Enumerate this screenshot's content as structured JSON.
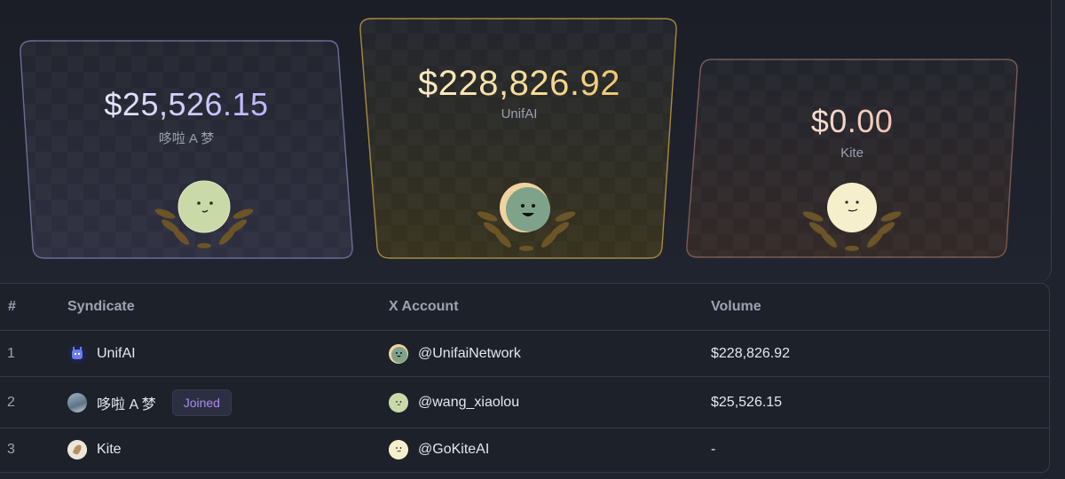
{
  "podium": [
    {
      "rank": 2,
      "amount": "$25,526.15",
      "name": "哆啦 A 梦",
      "accent": "#a69cf2"
    },
    {
      "rank": 1,
      "amount": "$228,826.92",
      "name": "UnifAI",
      "accent": "#e5b850"
    },
    {
      "rank": 3,
      "amount": "$0.00",
      "name": "Kite",
      "accent": "#e89a82"
    }
  ],
  "table": {
    "headers": {
      "rank": "#",
      "syndicate": "Syndicate",
      "x_account": "X Account",
      "volume": "Volume"
    },
    "rows": [
      {
        "rank": "1",
        "syndicate": "UnifAI",
        "joined": "",
        "x_account": "@UnifaiNetwork",
        "volume": "$228,826.92",
        "avatar_icon": "unifai-logo-icon"
      },
      {
        "rank": "2",
        "syndicate": "哆啦 A 梦",
        "joined": "Joined",
        "x_account": "@wang_xiaolou",
        "volume": "$25,526.15",
        "avatar_icon": "photo-avatar-icon"
      },
      {
        "rank": "3",
        "syndicate": "Kite",
        "joined": "",
        "x_account": "@GoKiteAI",
        "volume": "-",
        "avatar_icon": "kite-avatar-icon"
      }
    ]
  }
}
